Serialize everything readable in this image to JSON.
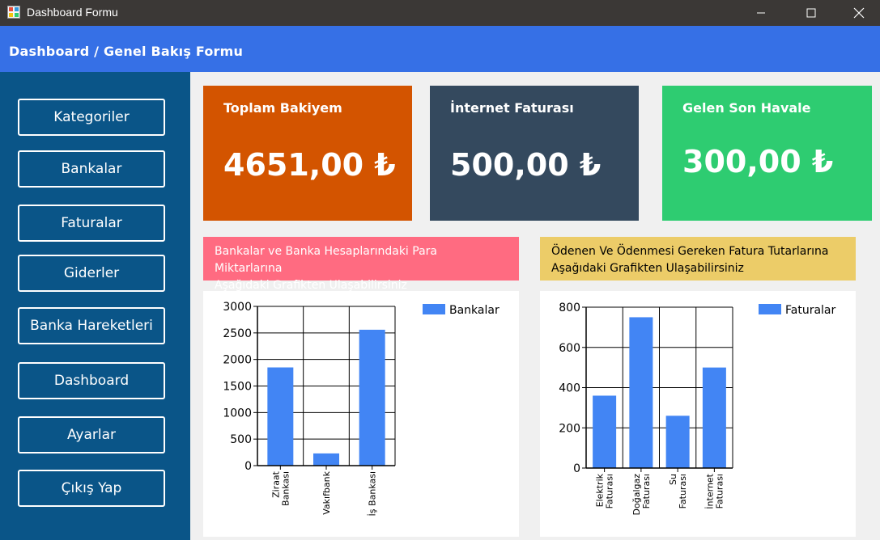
{
  "window": {
    "title": "Dashboard Formu",
    "controls": [
      "minimize-icon",
      "maximize-icon",
      "close-icon"
    ]
  },
  "header": {
    "title": "Dashboard / Genel Bakış Formu"
  },
  "sidebar": {
    "items": [
      {
        "label": "Kategoriler"
      },
      {
        "label": "Bankalar"
      },
      {
        "label": "Faturalar"
      },
      {
        "label": "Giderler"
      },
      {
        "label": "Banka Hareketleri"
      },
      {
        "label": "Dashboard"
      },
      {
        "label": "Ayarlar"
      },
      {
        "label": "Çıkış Yap"
      }
    ]
  },
  "cards": [
    {
      "label": "Toplam Bakiyem",
      "value": "4651,00 ₺",
      "color": "#d35400"
    },
    {
      "label": "İnternet Faturası",
      "value": "500,00 ₺",
      "color": "#34495e"
    },
    {
      "label": "Gelen Son Havale",
      "value": "300,00 ₺",
      "color": "#2ecc71"
    }
  ],
  "banners": [
    {
      "text_line1": "Bankalar ve Banka Hesaplarındaki Para Miktarlarına",
      "text_line2": "Aşağıdaki Grafikten Ulaşabilirsiniz",
      "color": "#ff6b81",
      "text_color": "#ffffff"
    },
    {
      "text_line1": "Ödenen Ve Ödenmesi Gereken Fatura Tutarlarına",
      "text_line2": "Aşağıdaki Grafikten Ulaşabilirsiniz",
      "color": "#eccc68",
      "text_color": "#000000"
    }
  ],
  "colors": {
    "bar": "#4285f4",
    "grid": "#000000"
  },
  "chart_data": [
    {
      "type": "bar",
      "categories": [
        [
          "Ziraat",
          "Bankası"
        ],
        [
          "Vakıfbank"
        ],
        [
          "İş Bankası"
        ]
      ],
      "series": [
        {
          "name": "Bankalar",
          "values": [
            1850,
            230,
            2560
          ]
        }
      ],
      "ylim": [
        0,
        3000
      ],
      "yticks": [
        0,
        500,
        1000,
        1500,
        2000,
        2500,
        3000
      ],
      "legend_position": "top-right",
      "grid": true
    },
    {
      "type": "bar",
      "categories": [
        [
          "Elektrik",
          "Faturası"
        ],
        [
          "Doğalgaz",
          "Faturası"
        ],
        [
          "Su",
          "Faturası"
        ],
        [
          "İnternet",
          "Faturası"
        ]
      ],
      "series": [
        {
          "name": "Faturalar",
          "values": [
            360,
            750,
            260,
            500
          ]
        }
      ],
      "ylim": [
        0,
        800
      ],
      "yticks": [
        0,
        200,
        400,
        600,
        800
      ],
      "legend_position": "top-right",
      "grid": true
    }
  ]
}
